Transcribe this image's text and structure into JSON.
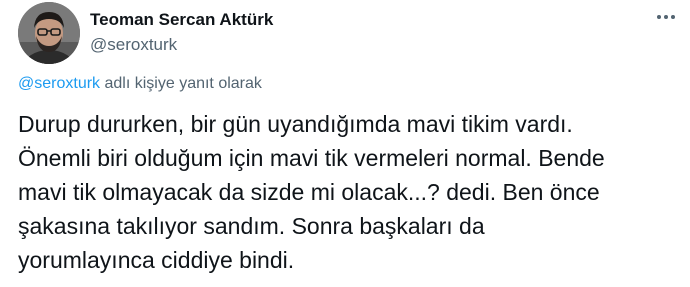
{
  "author": {
    "display_name": "Teoman Sercan Aktürk",
    "handle": "@seroxturk"
  },
  "more_icon": "more-horizontal-icon",
  "reply": {
    "handle": "@seroxturk",
    "suffix": " adlı kişiye yanıt olarak"
  },
  "tweet_text": [
    "Durup dururken, bir gün uyandığımda mavi tikim vardı.",
    "Önemli biri olduğum için mavi tik vermeleri normal. Bende",
    "mavi tik olmayacak da sizde mi olacak...? dedi. Ben önce",
    "şakasına takılıyor sandım. Sonra başkaları da",
    "yorumlayınca ciddiye bindi."
  ],
  "colors": {
    "text": "#0f1419",
    "secondary": "#536471",
    "link": "#1d9bf0"
  }
}
